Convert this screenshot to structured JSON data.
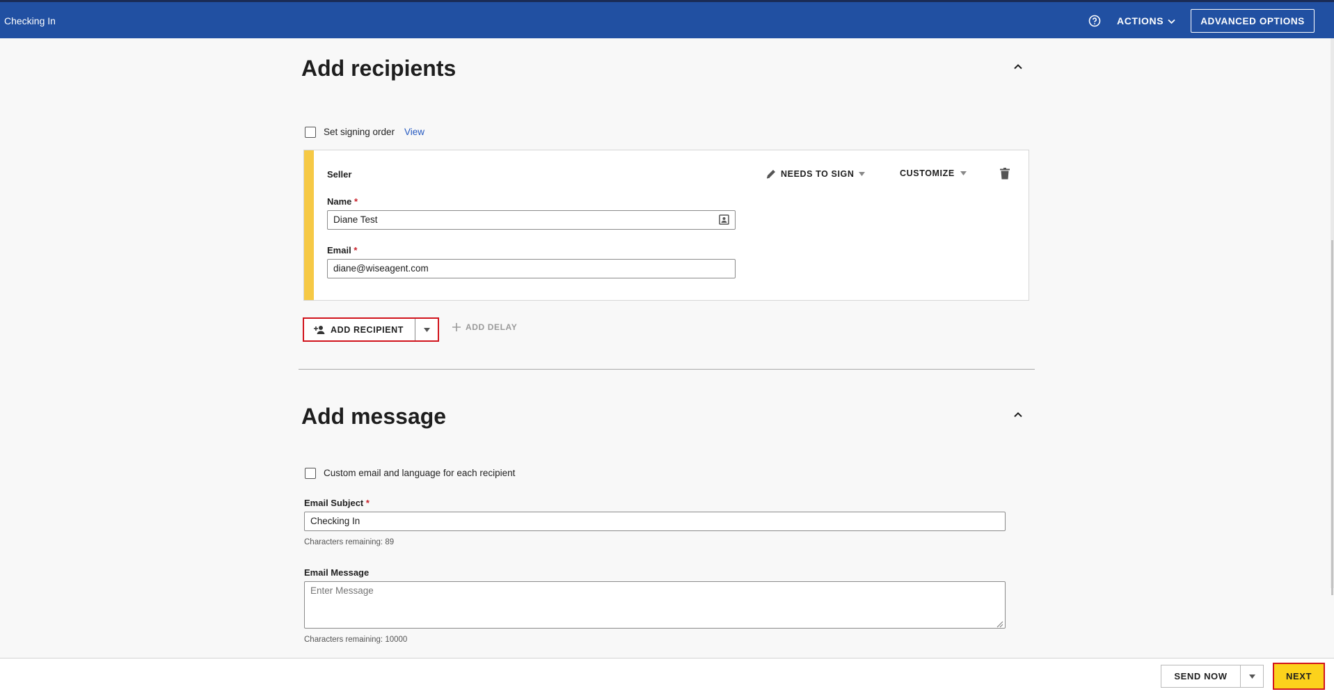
{
  "header": {
    "title": "Checking In",
    "actions_label": "ACTIONS",
    "advanced_options_label": "ADVANCED OPTIONS"
  },
  "recipients_section": {
    "title": "Add recipients",
    "signing_order_label": "Set signing order",
    "view_link": "View",
    "recipient": {
      "role": "Seller",
      "action_label": "NEEDS TO SIGN",
      "customize_label": "CUSTOMIZE",
      "name_label": "Name",
      "name_value": "Diane Test",
      "email_label": "Email",
      "email_value": "diane@wiseagent.com"
    },
    "add_recipient_label": "ADD RECIPIENT",
    "add_delay_label": "ADD DELAY"
  },
  "message_section": {
    "title": "Add message",
    "custom_email_label": "Custom email and language for each recipient",
    "subject_label": "Email Subject",
    "subject_value": "Checking In",
    "subject_remaining": "Characters remaining: 89",
    "message_label": "Email Message",
    "message_placeholder": "Enter Message",
    "message_remaining": "Characters remaining: 10000"
  },
  "footer": {
    "send_now_label": "SEND NOW",
    "next_label": "NEXT"
  },
  "colors": {
    "header_bg": "#2150a2",
    "stripe": "#f6c945",
    "highlight_border": "#d1131c",
    "next_bg": "#fcd21c",
    "link": "#2458c0"
  }
}
